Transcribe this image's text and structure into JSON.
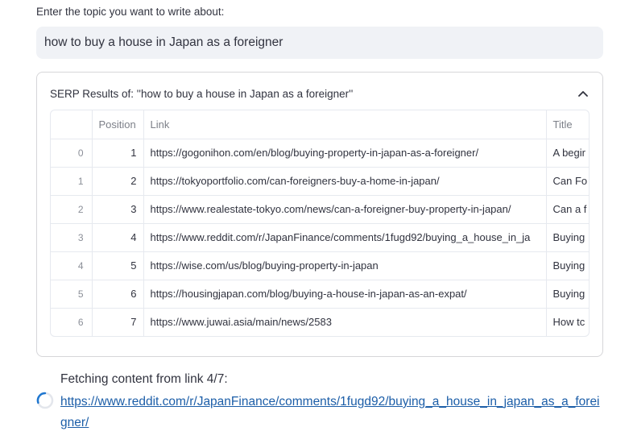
{
  "topic": {
    "label": "Enter the topic you want to write about:",
    "value": "how to buy a house in Japan as a foreigner"
  },
  "expander": {
    "title": "SERP Results of: ''how to buy a house in Japan as a foreigner''",
    "icon": "chevron-up-icon",
    "expanded": true
  },
  "table": {
    "columns": [
      "",
      "Position",
      "Link",
      "Title"
    ],
    "rows": [
      {
        "index": "0",
        "position": "1",
        "link": "https://gogonihon.com/en/blog/buying-property-in-japan-as-a-foreigner/",
        "title": "A begir"
      },
      {
        "index": "1",
        "position": "2",
        "link": "https://tokyoportfolio.com/can-foreigners-buy-a-home-in-japan/",
        "title": "Can Fo"
      },
      {
        "index": "2",
        "position": "3",
        "link": "https://www.realestate-tokyo.com/news/can-a-foreigner-buy-property-in-japan/",
        "title": "Can a f"
      },
      {
        "index": "3",
        "position": "4",
        "link": "https://www.reddit.com/r/JapanFinance/comments/1fugd92/buying_a_house_in_ja",
        "title": "Buying"
      },
      {
        "index": "4",
        "position": "5",
        "link": "https://wise.com/us/blog/buying-property-in-japan",
        "title": "Buying"
      },
      {
        "index": "5",
        "position": "6",
        "link": "https://housingjapan.com/blog/buying-a-house-in-japan-as-an-expat/",
        "title": "Buying"
      },
      {
        "index": "6",
        "position": "7",
        "link": "https://www.juwai.asia/main/news/2583",
        "title": "How tc"
      }
    ]
  },
  "status": {
    "text": "Fetching content from link 4/7:",
    "link": "https://www.reddit.com/r/JapanFinance/comments/1fugd92/buying_a_house_in_japan_as_a_foreigner/",
    "spinner_icon": "loading-spinner-icon",
    "link_color": "#1c5ea8"
  }
}
